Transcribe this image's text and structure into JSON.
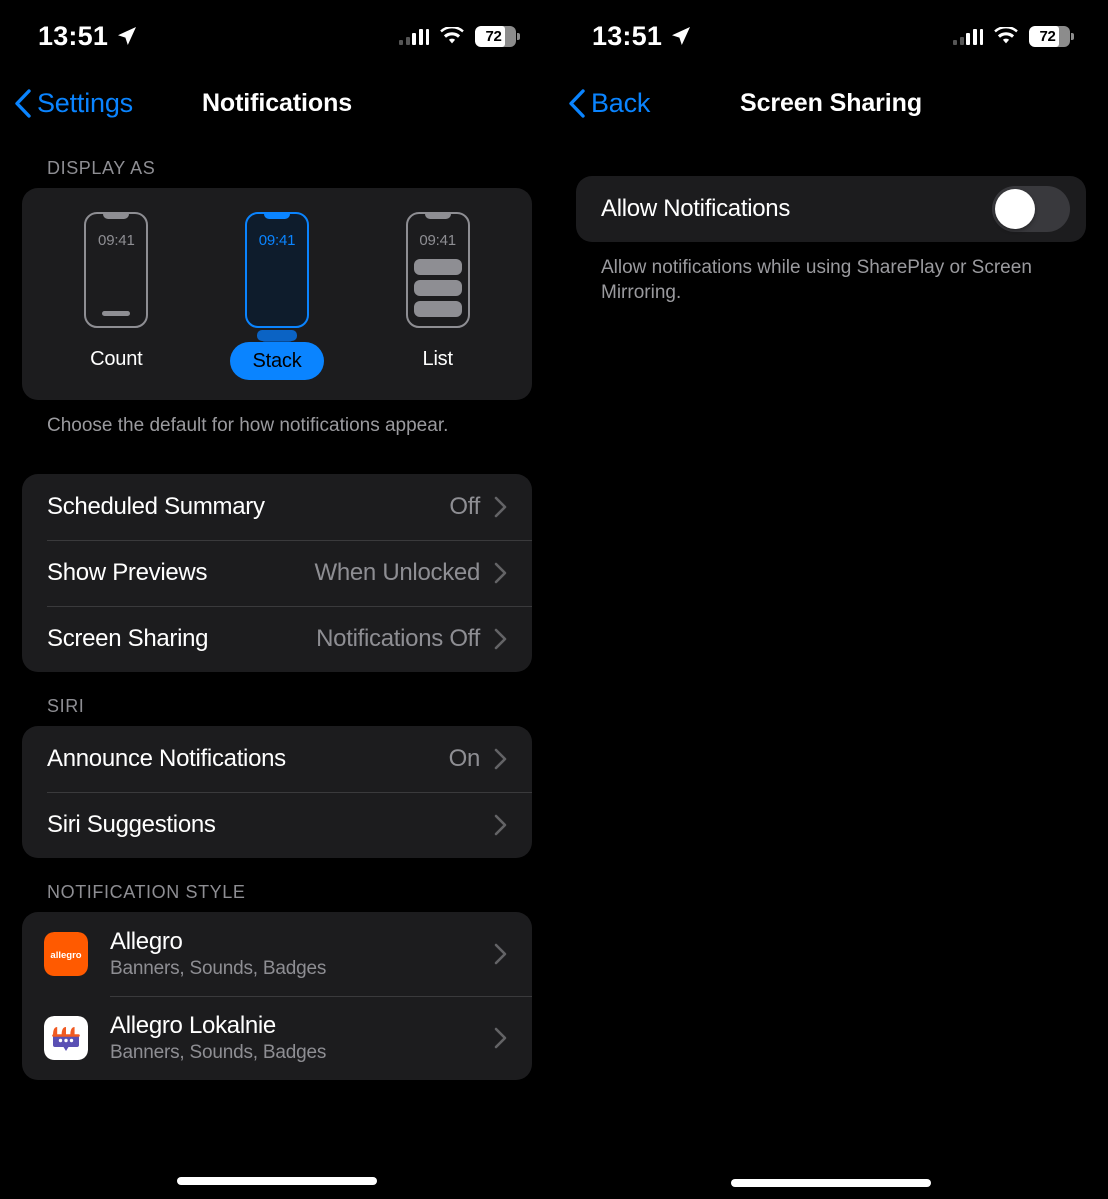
{
  "left": {
    "status": {
      "time": "13:51",
      "location_icon": "location-arrow-icon",
      "battery_level": "72",
      "wifi_icon": "wifi-icon",
      "cellular_icon": "cellular-bars-icon"
    },
    "nav": {
      "back_label": "Settings",
      "title": "Notifications",
      "back_icon": "chevron-left-icon"
    },
    "display_as": {
      "header": "DISPLAY AS",
      "footnote": "Choose the default for how notifications appear.",
      "options": [
        {
          "label": "Count",
          "preview_time": "09:41",
          "selected": false
        },
        {
          "label": "Stack",
          "preview_time": "09:41",
          "selected": true
        },
        {
          "label": "List",
          "preview_time": "09:41",
          "selected": false
        }
      ]
    },
    "general_rows": [
      {
        "label": "Scheduled Summary",
        "value": "Off"
      },
      {
        "label": "Show Previews",
        "value": "When Unlocked"
      },
      {
        "label": "Screen Sharing",
        "value": "Notifications Off"
      }
    ],
    "siri": {
      "header": "SIRI",
      "rows": [
        {
          "label": "Announce Notifications",
          "value": "On"
        },
        {
          "label": "Siri Suggestions",
          "value": ""
        }
      ]
    },
    "notification_style": {
      "header": "NOTIFICATION STYLE",
      "apps": [
        {
          "name": "Allegro",
          "subtitle": "Banners, Sounds, Badges",
          "icon": "allegro-app-icon",
          "icon_color": "#FF5A00"
        },
        {
          "name": "Allegro Lokalnie",
          "subtitle": "Banners, Sounds, Badges",
          "icon": "allegro-lokalnie-app-icon",
          "icon_color": "#FFFFFF"
        }
      ]
    }
  },
  "right": {
    "status": {
      "time": "13:51",
      "location_icon": "location-arrow-icon",
      "battery_level": "72",
      "wifi_icon": "wifi-icon",
      "cellular_icon": "cellular-bars-icon"
    },
    "nav": {
      "back_label": "Back",
      "title": "Screen Sharing",
      "back_icon": "chevron-left-icon"
    },
    "allow": {
      "label": "Allow Notifications",
      "state": "off",
      "footnote": "Allow notifications while using SharePlay or Screen Mirroring."
    }
  },
  "colors": {
    "accent": "#0A84FF",
    "card": "#1C1C1E",
    "separator": "#3A3A3C",
    "secondary_text": "#8E8E93",
    "background": "#000000"
  }
}
